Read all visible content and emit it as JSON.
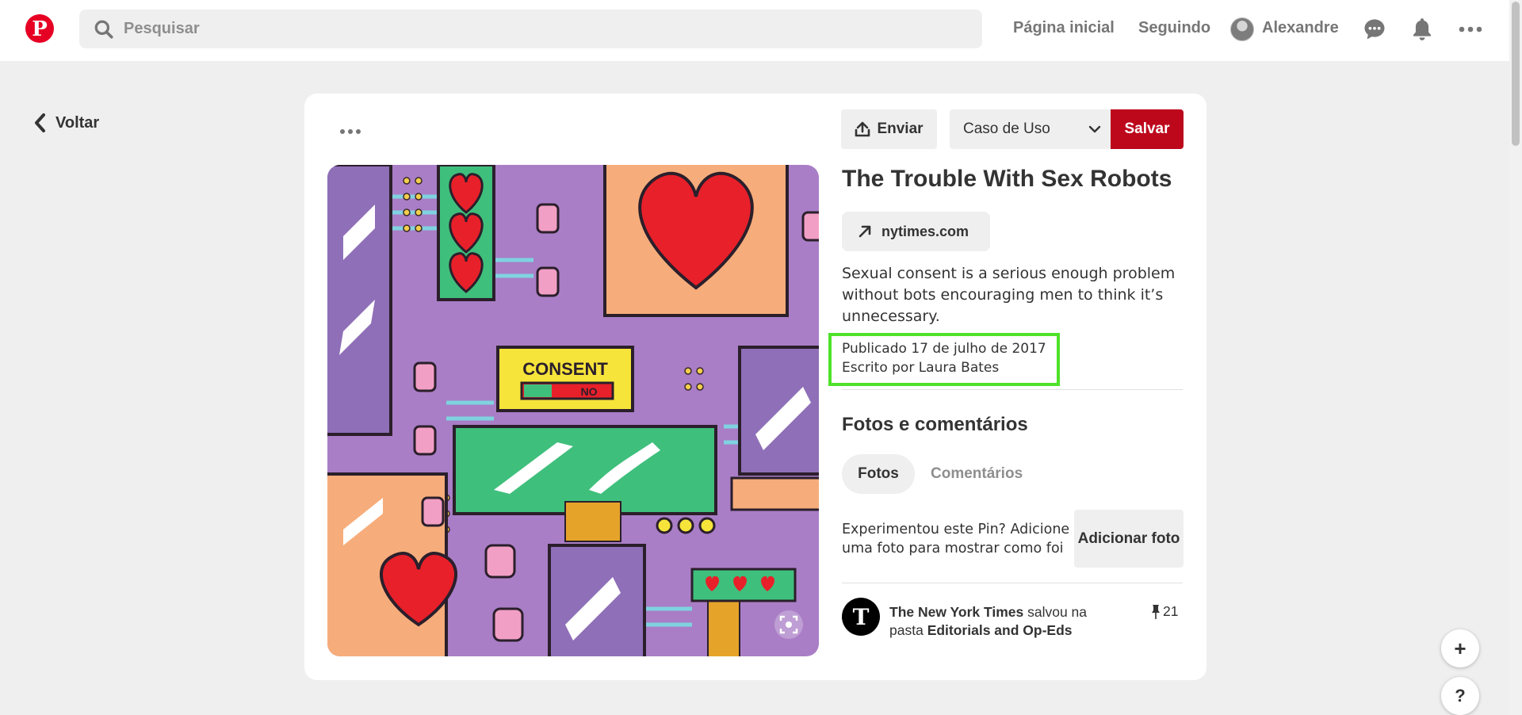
{
  "header": {
    "search_placeholder": "Pesquisar",
    "nav_home": "Página inicial",
    "nav_following": "Seguindo",
    "user_name": "Alexandre",
    "logo_letter": "P"
  },
  "back": {
    "label": "Voltar"
  },
  "pin": {
    "send_label": "Enviar",
    "board_selected": "Caso de Uso",
    "save_label": "Salvar",
    "title": "The Trouble With Sex Robots",
    "source": "nytimes.com",
    "description": "Sexual consent is a serious enough problem without bots encouraging men to think it’s unnecessary.",
    "published": "Publicado 17 de julho de 2017",
    "author": "Escrito por Laura Bates"
  },
  "image_text": {
    "consent": "CONSENT",
    "no": "NO"
  },
  "photos_section": {
    "title": "Fotos e comentários",
    "tab_photos": "Fotos",
    "tab_comments": "Comentários",
    "tried_prompt": "Experimentou este Pin? Adicione uma foto para mostrar como foi",
    "add_photo": "Adicionar foto"
  },
  "saved_by": {
    "avatar_letter": "T",
    "account": "The New York Times",
    "saved_in": " salvou na pasta ",
    "board": "Editorials and Op-Eds",
    "count": "21"
  },
  "fabs": {
    "plus": "+",
    "help": "?"
  },
  "colors": {
    "brand": "#e60023",
    "save": "#bd081c",
    "highlight": "#4ee229"
  }
}
